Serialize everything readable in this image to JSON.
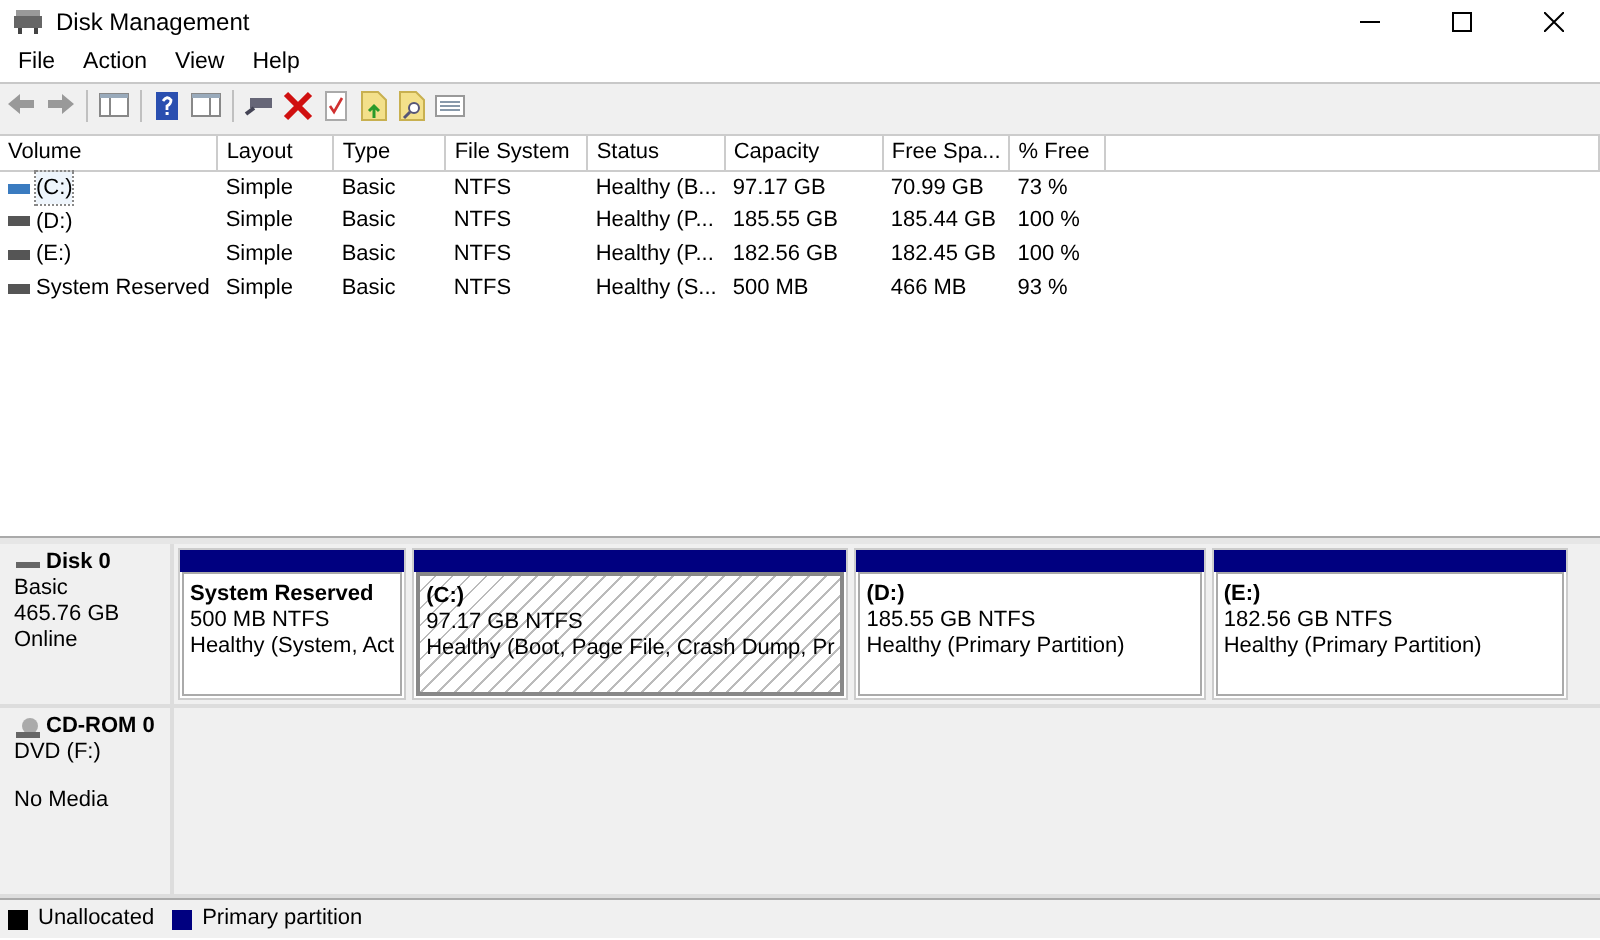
{
  "window": {
    "title": "Disk Management"
  },
  "menu": [
    "File",
    "Action",
    "View",
    "Help"
  ],
  "table": {
    "columns": [
      "Volume",
      "Layout",
      "Type",
      "File System",
      "Status",
      "Capacity",
      "Free Spa...",
      "% Free"
    ],
    "rows": [
      {
        "selected": true,
        "cells": [
          "(C:)",
          "Simple",
          "Basic",
          "NTFS",
          "Healthy (B...",
          "97.17 GB",
          "70.99 GB",
          "73 %"
        ]
      },
      {
        "selected": false,
        "cells": [
          "(D:)",
          "Simple",
          "Basic",
          "NTFS",
          "Healthy (P...",
          "185.55 GB",
          "185.44 GB",
          "100 %"
        ]
      },
      {
        "selected": false,
        "cells": [
          "(E:)",
          "Simple",
          "Basic",
          "NTFS",
          "Healthy (P...",
          "182.56 GB",
          "182.45 GB",
          "100 %"
        ]
      },
      {
        "selected": false,
        "cells": [
          "System Reserved",
          "Simple",
          "Basic",
          "NTFS",
          "Healthy (S...",
          "500 MB",
          "466 MB",
          "93 %"
        ]
      }
    ]
  },
  "disks": [
    {
      "kind": "disk",
      "name": "Disk 0",
      "lines": [
        "Basic",
        "465.76 GB",
        "Online"
      ],
      "partitions": [
        {
          "name": "System Reserved",
          "size": "500 MB NTFS",
          "status": "Healthy (System, Act",
          "selected": false
        },
        {
          "name": "(C:)",
          "size": "97.17 GB NTFS",
          "status": "Healthy (Boot, Page File, Crash Dump, Pr",
          "selected": true
        },
        {
          "name": "(D:)",
          "size": "185.55 GB NTFS",
          "status": "Healthy (Primary Partition)",
          "selected": false
        },
        {
          "name": "(E:)",
          "size": "182.56 GB NTFS",
          "status": "Healthy (Primary Partition)",
          "selected": false
        }
      ]
    },
    {
      "kind": "cdrom",
      "name": "CD-ROM 0",
      "lines": [
        "DVD (F:)",
        "No Media"
      ]
    }
  ],
  "legend": [
    {
      "label": "Unallocated",
      "color": "#000000"
    },
    {
      "label": "Primary partition",
      "color": "#000080"
    }
  ]
}
